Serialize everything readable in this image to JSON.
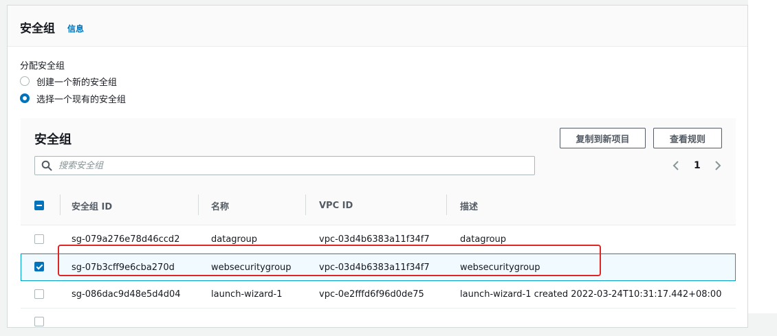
{
  "section": {
    "title": "安全组",
    "info_link": "信息",
    "assign_label": "分配安全组",
    "radio_options": [
      {
        "label": "创建一个新的安全组",
        "checked": false
      },
      {
        "label": "选择一个现有的安全组",
        "checked": true
      }
    ]
  },
  "table": {
    "title": "安全组",
    "buttons": {
      "copy": "复制到新项目",
      "view_rules": "查看规则"
    },
    "search": {
      "placeholder": "搜索安全组",
      "value": ""
    },
    "pagination": {
      "current_page": "1"
    },
    "columns": [
      "安全组 ID",
      "名称",
      "VPC ID",
      "描述"
    ],
    "rows": [
      {
        "id": "sg-079a276e78d46ccd2",
        "name": "datagroup",
        "vpc": "vpc-03d4b6383a11f34f7",
        "desc": "datagroup",
        "selected": false
      },
      {
        "id": "sg-07b3cff9e6cba270d",
        "name": "websecuritygroup",
        "vpc": "vpc-03d4b6383a11f34f7",
        "desc": "websecuritygroup",
        "selected": true
      },
      {
        "id": "sg-086dac9d48e5d4d04",
        "name": "launch-wizard-1",
        "vpc": "vpc-0e2fffd6f96d0de75",
        "desc": "launch-wizard-1 created 2022-03-24T10:31:17.442+08:00",
        "selected": false
      }
    ]
  },
  "colors": {
    "accent": "#0073bb",
    "selected_row_bg": "#f1faff",
    "selected_row_border": "#00a1c9",
    "highlight": "#e02424"
  },
  "icons": {
    "search": "search-icon",
    "prev": "chevron-left-icon",
    "next": "chevron-right-icon"
  }
}
